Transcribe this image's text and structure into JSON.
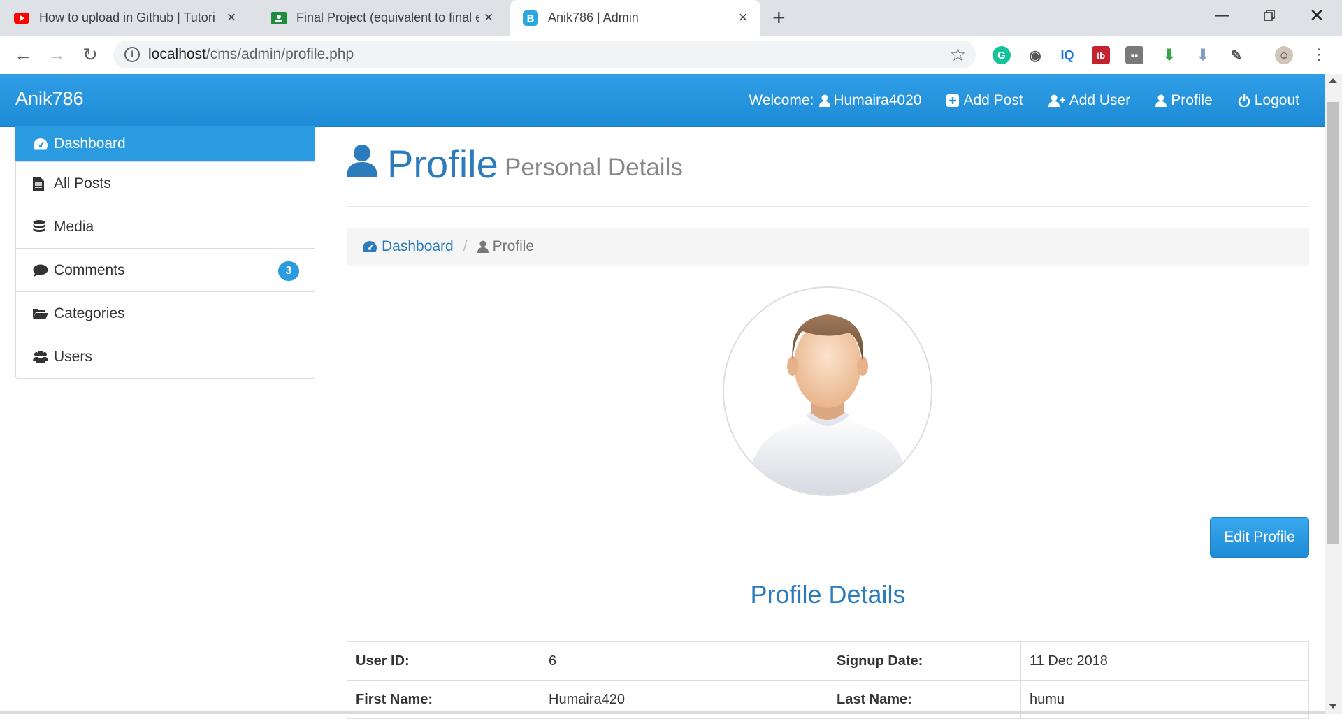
{
  "browser": {
    "tabs": [
      {
        "title": "How to upload in Github | Tutori",
        "icon": "youtube-icon",
        "active": false
      },
      {
        "title": "Final Project (equivalent to final e",
        "icon": "classroom-icon",
        "active": false
      },
      {
        "title": "Anik786 | Admin",
        "icon": "bootstrap-icon",
        "active": true
      }
    ],
    "url_host": "localhost",
    "url_path": "/cms/admin/profile.php",
    "colors": {
      "tabbar": "#dee1e6",
      "toolbar": "#ffffff"
    }
  },
  "app": {
    "brand": "Anik786",
    "welcome_label": "Welcome:",
    "welcome_user": "Humaira4020",
    "nav": {
      "add_post": "Add Post",
      "add_user": "Add User",
      "profile": "Profile",
      "logout": "Logout"
    },
    "accent": "#2a9be0"
  },
  "sidebar": {
    "items": [
      {
        "label": "Dashboard",
        "icon": "dashboard-icon",
        "active": true
      },
      {
        "label": "All Posts",
        "icon": "file-icon"
      },
      {
        "label": "Media",
        "icon": "database-icon"
      },
      {
        "label": "Comments",
        "icon": "comment-icon",
        "badge": "3"
      },
      {
        "label": "Categories",
        "icon": "folder-open-icon"
      },
      {
        "label": "Users",
        "icon": "users-icon"
      }
    ]
  },
  "page": {
    "title": "Profile",
    "subtitle": "Personal Details",
    "breadcrumb": {
      "home": "Dashboard",
      "current": "Profile"
    },
    "edit_button": "Edit Profile",
    "details_title": "Profile Details",
    "details": {
      "user_id_label": "User ID:",
      "user_id": "6",
      "signup_label": "Signup Date:",
      "signup": "11 Dec 2018",
      "first_name_label": "First Name:",
      "first_name": "Humaira420",
      "last_name_label": "Last Name:",
      "last_name": "humu"
    }
  }
}
